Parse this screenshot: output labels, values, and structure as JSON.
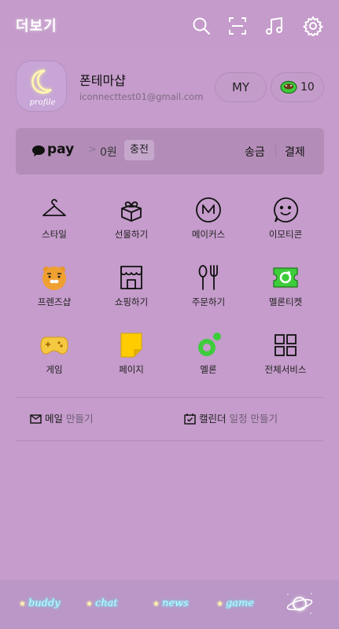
{
  "header": {
    "title": "더보기"
  },
  "profile": {
    "name": "폰테마샵",
    "email": "iconnecttest01@gmail.com",
    "my_label": "MY",
    "coins": "10",
    "avatar_text": "profile"
  },
  "pay": {
    "label": "pay",
    "chevron": ">",
    "amount": "0원",
    "charge": "충전",
    "send": "송금",
    "payment": "결제"
  },
  "menu": [
    {
      "label": "스타일",
      "icon": "hanger-icon"
    },
    {
      "label": "선물하기",
      "icon": "gift-icon"
    },
    {
      "label": "메이커스",
      "icon": "makers-m-icon"
    },
    {
      "label": "이모티콘",
      "icon": "smile-emoticon-icon"
    },
    {
      "label": "프렌즈샵",
      "icon": "ryan-friends-icon"
    },
    {
      "label": "쇼핑하기",
      "icon": "shop-icon"
    },
    {
      "label": "주문하기",
      "icon": "fork-spoon-icon"
    },
    {
      "label": "멜론티켓",
      "icon": "melon-ticket-icon"
    },
    {
      "label": "게임",
      "icon": "gamepad-icon"
    },
    {
      "label": "페이지",
      "icon": "page-icon"
    },
    {
      "label": "멜론",
      "icon": "melon-icon"
    },
    {
      "label": "전체서비스",
      "icon": "grid-icon"
    }
  ],
  "quick": {
    "mail_bold": "메일",
    "mail_muted": "만들기",
    "calendar_bold": "캘린더",
    "calendar_muted": "일정 만들기"
  },
  "tabs": [
    {
      "label": "buddy"
    },
    {
      "label": "chat"
    },
    {
      "label": "news"
    },
    {
      "label": "game"
    }
  ],
  "colors": {
    "background": "#c59ccb",
    "pay_bar": "#b38db8",
    "neon_text": "#b8fbff",
    "melon_green": "#3ecc3c",
    "ryan_orange": "#f0a030",
    "game_yellow": "#f5c842"
  }
}
